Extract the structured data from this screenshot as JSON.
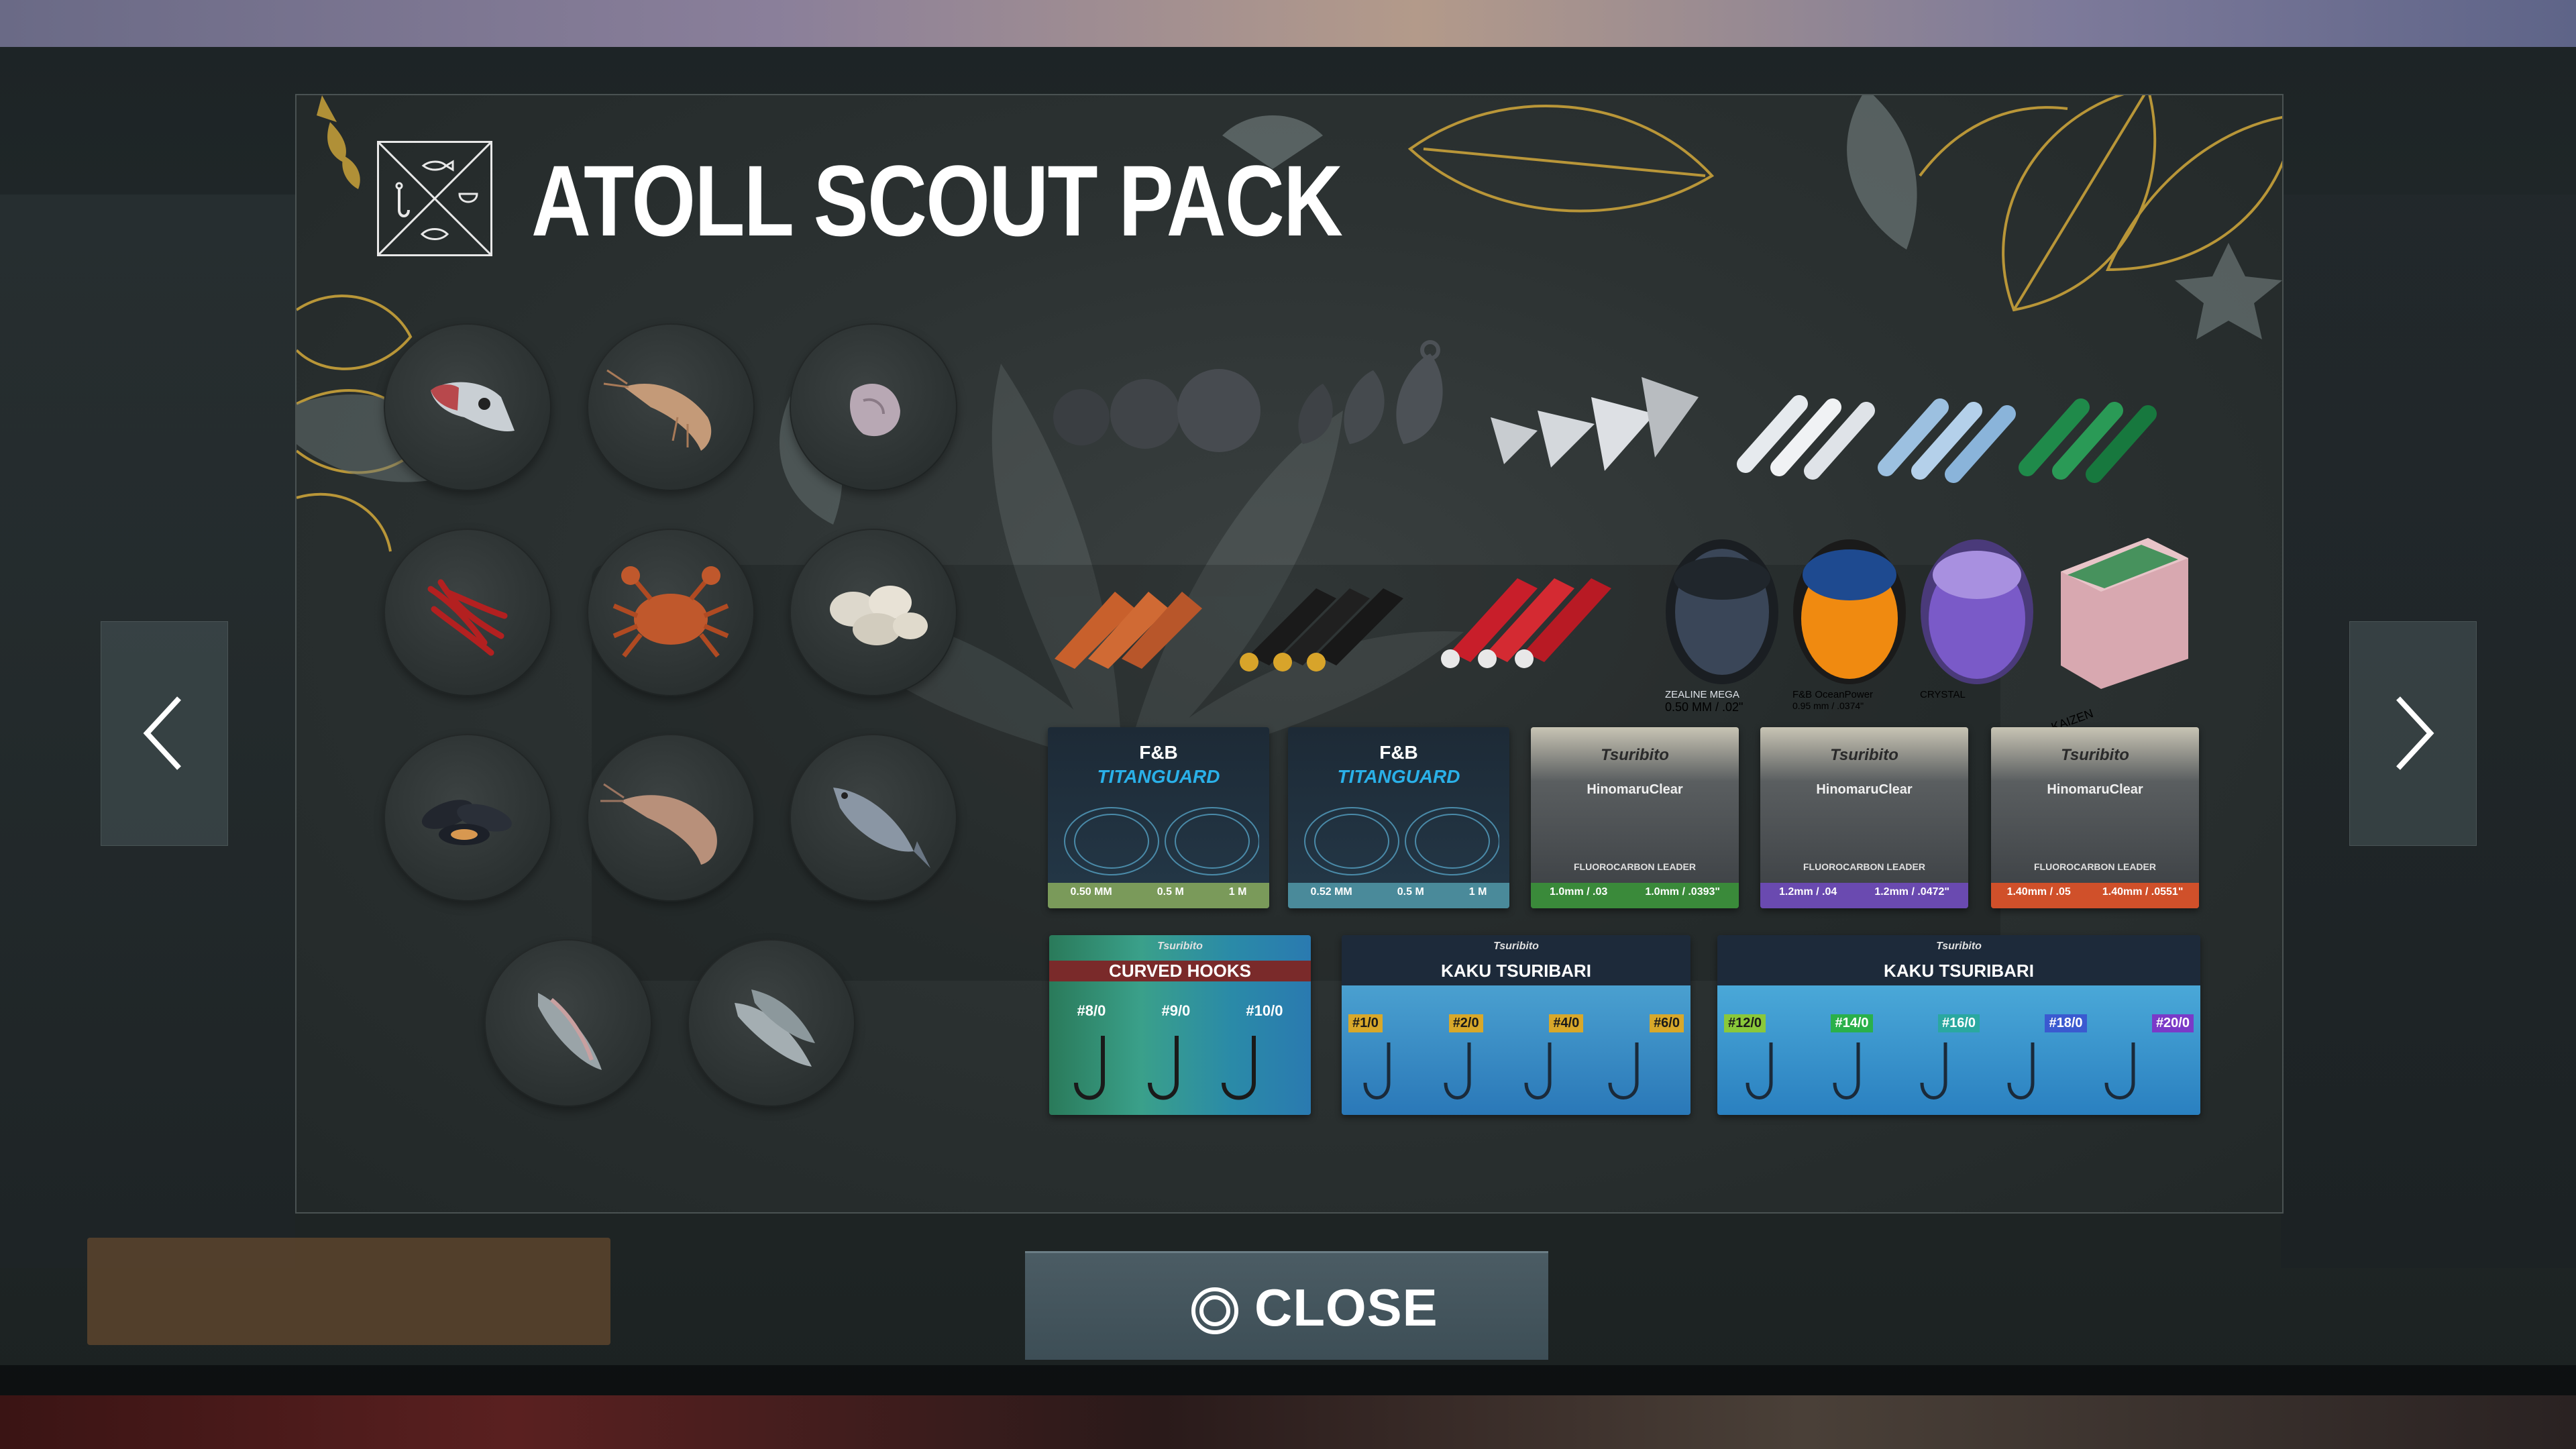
{
  "pack": {
    "title": "ATOLL SCOUT PACK"
  },
  "close": {
    "label": "CLOSE"
  },
  "colors": {
    "panel_bg": "#2c3232",
    "title_text": "#ffffff",
    "accent_gold": "#c9a23a",
    "close_bg": "#445760"
  },
  "icons": {
    "pack_logo": "fishing-hook-fish-emblem-icon",
    "prev": "chevron-left-icon",
    "next": "chevron-right-icon",
    "close": "circle-button-icon"
  },
  "baits": [
    "fish-head",
    "shrimp",
    "squid-piece",
    "bloodworms",
    "crab",
    "clams",
    "mussels",
    "prawn",
    "whole-fish",
    "fish-fillet",
    "fish-strip"
  ],
  "sinkers": [
    "round sinkers",
    "bank sinkers",
    "pyramid sinkers"
  ],
  "jigs": [
    "white jigs",
    "blue jigs",
    "green jigs"
  ],
  "lures": [
    "orange bucktail jigs",
    "black bucktail jigs",
    "red bucktail jigs"
  ],
  "spools": [
    {
      "brand": "ZEALINE MEGA",
      "spec": "0.50 MM / .02\""
    },
    {
      "brand": "F&B OceanPower",
      "spec": "0.95 mm / .0374\""
    },
    {
      "brand": "CRYSTAL",
      "spec": ""
    },
    {
      "brand": "KAIZEN",
      "spec": ""
    }
  ],
  "leaders": [
    {
      "brand": "F&B",
      "name": "TITANGUARD",
      "sizes": [
        "0.50 MM",
        "0.5 M",
        "1 M"
      ]
    },
    {
      "brand": "F&B",
      "name": "TITANGUARD",
      "sizes": [
        "0.52 MM",
        "0.5 M",
        "1 M"
      ]
    },
    {
      "brand": "Tsuribito",
      "name": "HinomaruClear",
      "type": "FLUOROCARBON LEADER",
      "sizes": [
        "1.0mm / .03",
        "1.0mm / .0393\""
      ]
    },
    {
      "brand": "Tsuribito",
      "name": "HinomaruClear",
      "type": "FLUOROCARBON LEADER",
      "sizes": [
        "1.2mm / .04",
        "1.2mm / .0472\""
      ]
    },
    {
      "brand": "Tsuribito",
      "name": "HinomaruClear",
      "type": "FLUOROCARBON LEADER",
      "sizes": [
        "1.40mm / .05",
        "1.40mm / .0551\""
      ]
    }
  ],
  "hooks_curved": {
    "brand": "Tsuribito",
    "name": "CURVED HOOKS",
    "sizes": [
      "#8/0",
      "#9/0",
      "#10/0"
    ]
  },
  "hooks_kaku_1": {
    "brand": "Tsuribito",
    "name": "KAKU TSURIBARI",
    "sizes": [
      "#1/0",
      "#2/0",
      "#4/0",
      "#6/0"
    ]
  },
  "hooks_kaku_2": {
    "brand": "Tsuribito",
    "name": "KAKU TSURIBARI",
    "sizes": [
      "#12/0",
      "#14/0",
      "#16/0",
      "#18/0",
      "#20/0"
    ]
  }
}
